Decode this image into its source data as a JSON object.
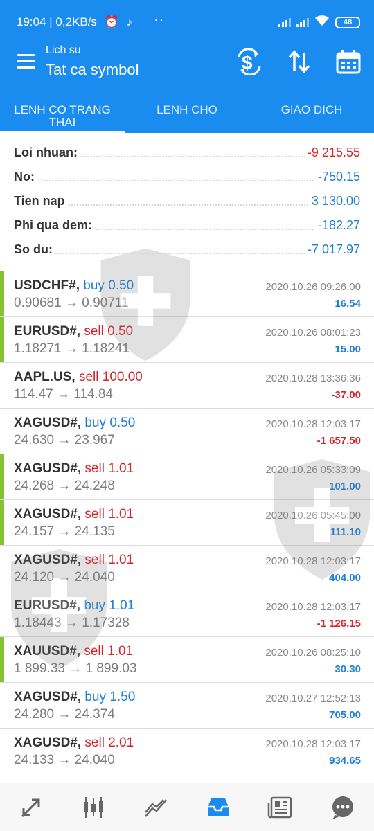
{
  "status": {
    "time_speed": "19:04 | 0,2KB/s",
    "battery": "48"
  },
  "header": {
    "subtitle": "Lich su",
    "title": "Tat ca symbol"
  },
  "tabs": [
    {
      "label": "LENH CO TRANG THAI"
    },
    {
      "label": "LENH CHO"
    },
    {
      "label": "GIAO DICH"
    }
  ],
  "summary": [
    {
      "label": "Loi nhuan:",
      "value": "-9 215.55"
    },
    {
      "label": "No:",
      "value": "-750.15"
    },
    {
      "label": "Tien nap",
      "value": "3 130.00"
    },
    {
      "label": "Phi qua dem:",
      "value": "-182.27"
    },
    {
      "label": "So du:",
      "value": "-7 017.97"
    }
  ],
  "trades": [
    {
      "symbol": "USDCHF#,",
      "side": "buy 0.50",
      "prices": "0.90681 → 0.90711",
      "time": "2020.10.26 09:26:00",
      "profit": "16.54"
    },
    {
      "symbol": "EURUSD#,",
      "side": "sell 0.50",
      "prices": "1.18271 → 1.18241",
      "time": "2020.10.26 08:01:23",
      "profit": "15.00"
    },
    {
      "symbol": "AAPL.US,",
      "side": "sell 100.00",
      "prices": "114.47 → 114.84",
      "time": "2020.10.28 13:36:36",
      "profit": "-37.00"
    },
    {
      "symbol": "XAGUSD#,",
      "side": "buy 0.50",
      "prices": "24.630 → 23.967",
      "time": "2020.10.28 12:03:17",
      "profit": "-1 657.50"
    },
    {
      "symbol": "XAGUSD#,",
      "side": "sell 1.01",
      "prices": "24.268 → 24.248",
      "time": "2020.10.26 05:33:09",
      "profit": "101.00"
    },
    {
      "symbol": "XAGUSD#,",
      "side": "sell 1.01",
      "prices": "24.157 → 24.135",
      "time": "2020.10.26 05:45:00",
      "profit": "111.10"
    },
    {
      "symbol": "XAGUSD#,",
      "side": "sell 1.01",
      "prices": "24.120 → 24.040",
      "time": "2020.10.28 12:03:17",
      "profit": "404.00"
    },
    {
      "symbol": "EURUSD#,",
      "side": "buy 1.01",
      "prices": "1.18443 → 1.17328",
      "time": "2020.10.28 12:03:17",
      "profit": "-1 126.15"
    },
    {
      "symbol": "XAUUSD#,",
      "side": "sell 1.01",
      "prices": "1 899.33 → 1 899.03",
      "time": "2020.10.26 08:25:10",
      "profit": "30.30"
    },
    {
      "symbol": "XAGUSD#,",
      "side": "buy 1.50",
      "prices": "24.280 → 24.374",
      "time": "2020.10.27 12:52:13",
      "profit": "705.00"
    },
    {
      "symbol": "XAGUSD#,",
      "side": "sell 2.01",
      "prices": "24.133 → 24.040",
      "time": "2020.10.28 12:03:17",
      "profit": "934.65"
    }
  ],
  "icons": {
    "header": [
      "menu-icon",
      "currency-exchange-icon",
      "sort-icon",
      "calendar-icon"
    ],
    "bottom_nav": [
      "quotes-icon",
      "chart-icon",
      "trade-icon",
      "history-icon",
      "news-icon",
      "chat-icon"
    ]
  },
  "colors": {
    "header": "#1a8cf0",
    "profit": "#1f7fd6",
    "loss": "#d8232a",
    "active_bar": "#86c232",
    "nav_active": "#1a8cf0"
  }
}
